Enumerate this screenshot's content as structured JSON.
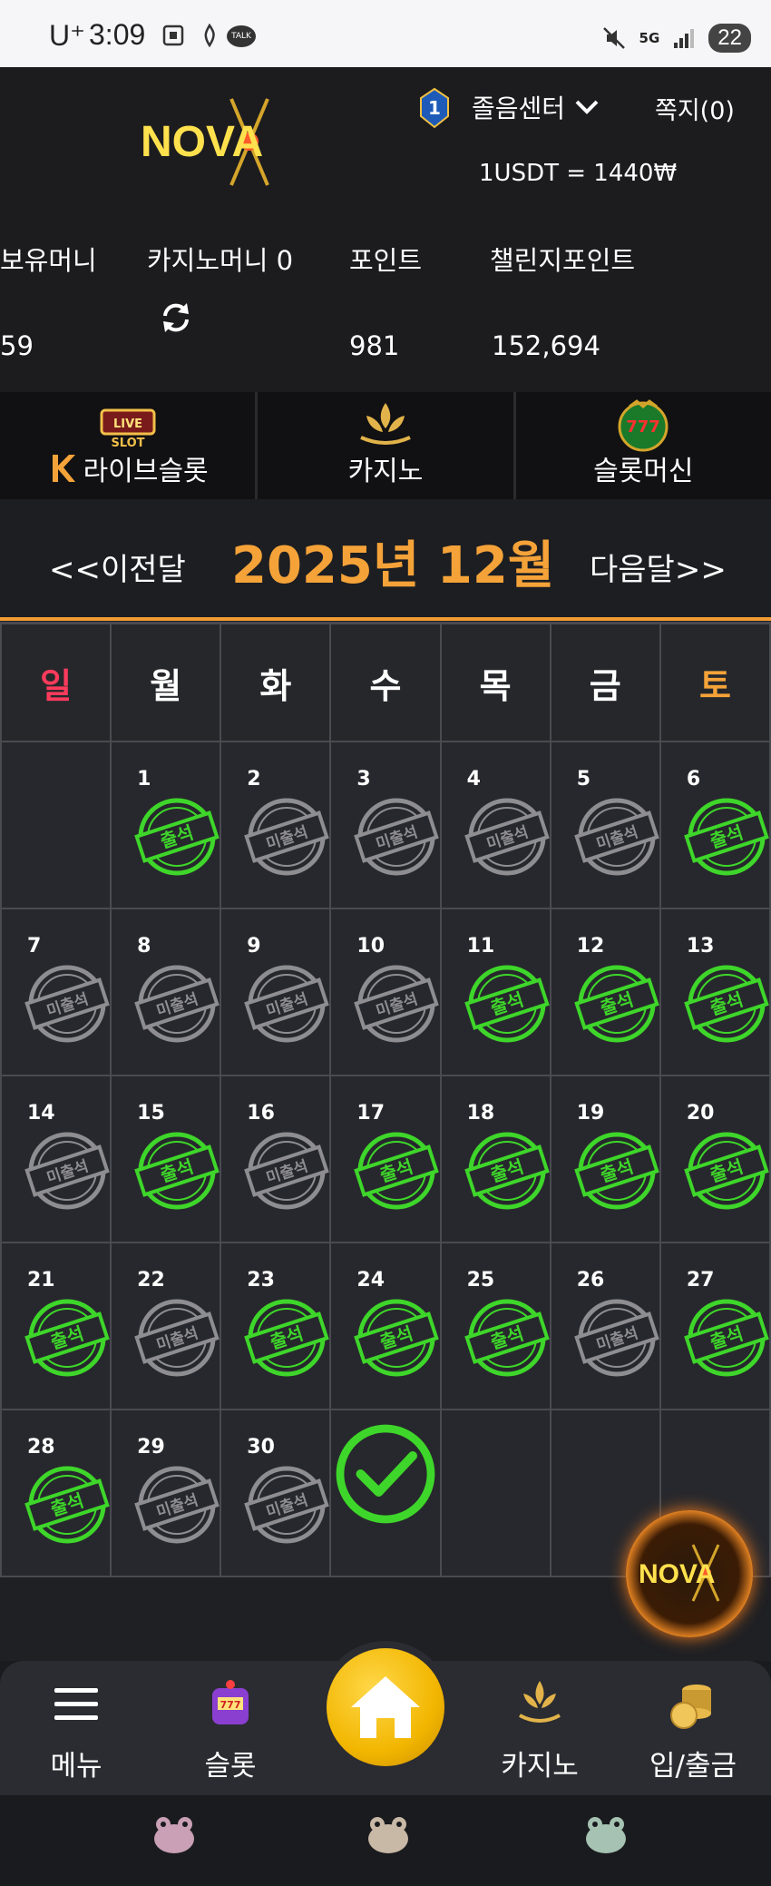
{
  "status_bar": {
    "carrier": "U⁺",
    "time": "3:09",
    "talk": "TALK",
    "network": "5G",
    "battery": "22"
  },
  "header": {
    "logo_text": "NOVA",
    "rank": "1",
    "center_label": "졸음센터",
    "messages_label": "쪽지(0)",
    "rate": "1USDT = 1440₩"
  },
  "wallet": {
    "hold_label": "보유머니",
    "hold_value": "59",
    "casino_label": "카지노머니 0",
    "point_label": "포인트",
    "point_value": "981",
    "challenge_label": "챌린지포인트",
    "challenge_value": "152,694"
  },
  "game_tabs": [
    {
      "label": "라이브슬롯",
      "icon": "live-slot-icon"
    },
    {
      "label": "카지노",
      "icon": "k-slot-icon"
    },
    {
      "label": "슬롯머신",
      "icon": "777-slots-icon"
    }
  ],
  "month_nav": {
    "prev": "<<이전달",
    "title": "2025년 12월",
    "next": "다음달>>"
  },
  "weekdays": [
    "일",
    "월",
    "화",
    "수",
    "목",
    "금",
    "토"
  ],
  "stamp_text": {
    "attended": "출석",
    "absent": "미출석"
  },
  "calendar": [
    [
      null,
      {
        "d": "1",
        "s": "attended"
      },
      {
        "d": "2",
        "s": "absent"
      },
      {
        "d": "3",
        "s": "absent"
      },
      {
        "d": "4",
        "s": "absent"
      },
      {
        "d": "5",
        "s": "absent"
      },
      {
        "d": "6",
        "s": "attended"
      }
    ],
    [
      {
        "d": "7",
        "s": "absent"
      },
      {
        "d": "8",
        "s": "absent"
      },
      {
        "d": "9",
        "s": "absent"
      },
      {
        "d": "10",
        "s": "absent"
      },
      {
        "d": "11",
        "s": "attended"
      },
      {
        "d": "12",
        "s": "attended"
      },
      {
        "d": "13",
        "s": "attended"
      }
    ],
    [
      {
        "d": "14",
        "s": "absent"
      },
      {
        "d": "15",
        "s": "attended"
      },
      {
        "d": "16",
        "s": "absent"
      },
      {
        "d": "17",
        "s": "attended"
      },
      {
        "d": "18",
        "s": "attended"
      },
      {
        "d": "19",
        "s": "attended"
      },
      {
        "d": "20",
        "s": "attended"
      }
    ],
    [
      {
        "d": "21",
        "s": "attended"
      },
      {
        "d": "22",
        "s": "absent"
      },
      {
        "d": "23",
        "s": "attended"
      },
      {
        "d": "24",
        "s": "attended"
      },
      {
        "d": "25",
        "s": "attended"
      },
      {
        "d": "26",
        "s": "absent"
      },
      {
        "d": "27",
        "s": "attended"
      }
    ],
    [
      {
        "d": "28",
        "s": "attended"
      },
      {
        "d": "29",
        "s": "absent"
      },
      {
        "d": "30",
        "s": "absent"
      },
      {
        "d": "",
        "s": "check"
      },
      null,
      null,
      null
    ]
  ],
  "colors": {
    "accent": "#f5a339",
    "attended": "#3ed62a",
    "absent": "#8d8d92",
    "sunday": "#ff3b5c"
  },
  "bottom_nav": {
    "menu": "메뉴",
    "slot": "슬롯",
    "home": "home-icon",
    "casino": "카지노",
    "bank": "입/출금"
  }
}
